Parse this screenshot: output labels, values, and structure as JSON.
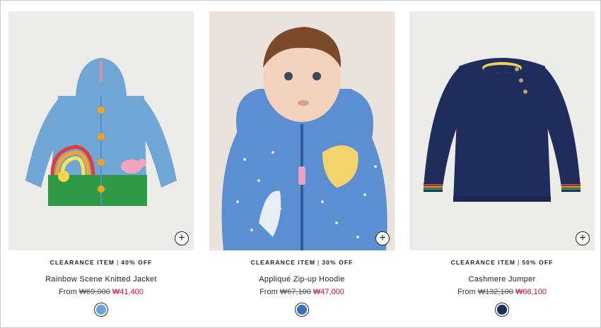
{
  "products": [
    {
      "tag": "CLEARANCE ITEM",
      "discount": "40% OFF",
      "name": "Rainbow Scene Knitted Jacket",
      "price_prefix": "From",
      "old_price": "₩69,000",
      "new_price": "₩41,400",
      "swatch_color": "#6aa3da",
      "quick_add": "+"
    },
    {
      "tag": "CLEARANCE ITEM",
      "discount": "30% OFF",
      "name": "Appliqué Zip-up Hoodie",
      "price_prefix": "From",
      "old_price": "₩67,100",
      "new_price": "₩47,000",
      "swatch_color": "#3a6fc0",
      "quick_add": "+"
    },
    {
      "tag": "CLEARANCE ITEM",
      "discount": "50% OFF",
      "name": "Cashmere Jumper",
      "price_prefix": "From",
      "old_price": "₩132,100",
      "new_price": "₩66,100",
      "swatch_color": "#1f2d5c",
      "quick_add": "+"
    }
  ],
  "colors": {
    "sale_red": "#c8102e",
    "text": "#222222",
    "image_bg": "#eeece8"
  }
}
